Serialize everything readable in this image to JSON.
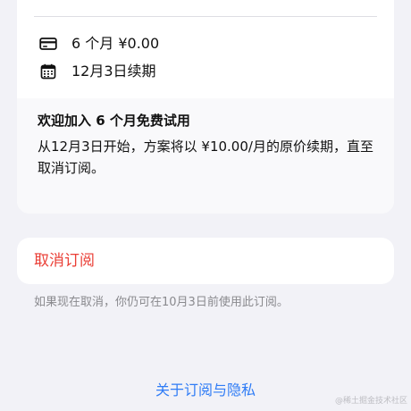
{
  "plan": {
    "price_line": "6 个月 ¥0.00",
    "renew_line": "12月3日续期",
    "icons": {
      "price": "credit-card-icon",
      "renew": "calendar-icon"
    }
  },
  "trial": {
    "title": "欢迎加入 6 个月免费试用",
    "body": "从12月3日开始，方案将以 ¥10.00/月的原价续期，直至取消订阅。"
  },
  "cancel": {
    "label": "取消订阅",
    "hint": "如果现在取消，你仍可在10月3日前使用此订阅。"
  },
  "footer": {
    "about_link": "关于订阅与隐私"
  },
  "watermark": "@稀土掘金技术社区",
  "colors": {
    "background": "#f2f2f7",
    "card": "#ffffff",
    "destructive": "#ea3e35",
    "link": "#2f7cf6",
    "secondary_text": "#8a8a8e"
  }
}
